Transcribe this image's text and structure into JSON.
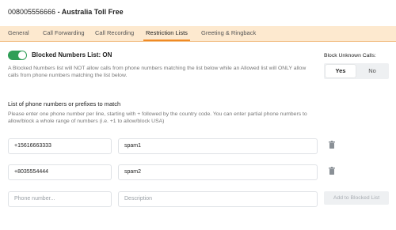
{
  "header": {
    "number": "008005556666",
    "separator": " - ",
    "name": "Australia Toll Free"
  },
  "tabs": [
    {
      "label": "General"
    },
    {
      "label": "Call Forwarding"
    },
    {
      "label": "Call Recording"
    },
    {
      "label": "Restriction Lists",
      "active": true
    },
    {
      "label": "Greeting & Ringback"
    }
  ],
  "toggle": {
    "label": "Blocked Numbers List: ON",
    "state": "on",
    "color": "#2f9e57"
  },
  "description": "A Blocked Numbers list will NOT allow calls from phone numbers matching the list below while an Allowed list will ONLY allow calls from phone numbers matching the list below.",
  "block_unknown": {
    "label": "Block Unknown Calls:",
    "options": [
      "Yes",
      "No"
    ],
    "selected": "Yes"
  },
  "list": {
    "title": "List of phone numbers or prefixes to match",
    "help": "Please enter one phone number per line, starting with + followed by the country code. You can enter partial phone numbers to allow/block a whole range of numbers (i.e. +1 to allow/block USA)",
    "entries": [
      {
        "number": "+15616663333",
        "description": "spam1"
      },
      {
        "number": "+8035554444",
        "description": "spam2"
      }
    ],
    "new_entry": {
      "number_placeholder": "Phone number...",
      "description_placeholder": "Description"
    },
    "add_button": "Add to Blocked List"
  },
  "colors": {
    "accent": "#f08a24",
    "tab_bar": "#fde9cf",
    "toggle_on": "#2f9e57"
  }
}
